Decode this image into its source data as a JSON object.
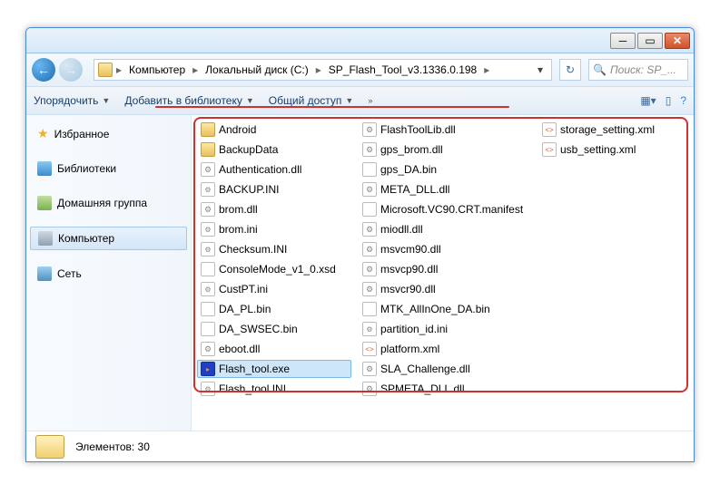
{
  "breadcrumb": {
    "seg1": "Компьютер",
    "seg2": "Локальный диск (C:)",
    "seg3": "SP_Flash_Tool_v3.1336.0.198"
  },
  "search": {
    "placeholder": "Поиск: SP_..."
  },
  "toolbar": {
    "organize": "Упорядочить",
    "addlib": "Добавить в библиотеку",
    "share": "Общий доступ"
  },
  "sidebar": {
    "fav": "Избранное",
    "lib": "Библиотеки",
    "home": "Домашняя группа",
    "comp": "Компьютер",
    "net": "Сеть"
  },
  "files": {
    "col1": [
      {
        "icon": "folder",
        "name": "Android"
      },
      {
        "icon": "folder",
        "name": "BackupData"
      },
      {
        "icon": "dll",
        "name": "Authentication.dll"
      },
      {
        "icon": "iniic",
        "name": "BACKUP.INI"
      },
      {
        "icon": "dll",
        "name": "brom.dll"
      },
      {
        "icon": "iniic",
        "name": "brom.ini"
      },
      {
        "icon": "iniic",
        "name": "Checksum.INI"
      },
      {
        "icon": "xsdic",
        "name": "ConsoleMode_v1_0.xsd"
      },
      {
        "icon": "iniic",
        "name": "CustPT.ini"
      },
      {
        "icon": "binic",
        "name": "DA_PL.bin"
      },
      {
        "icon": "binic",
        "name": "DA_SWSEC.bin"
      },
      {
        "icon": "dll",
        "name": "eboot.dll"
      },
      {
        "icon": "exeic",
        "name": "Flash_tool.exe",
        "sel": true
      },
      {
        "icon": "iniic",
        "name": "Flash_tool.INI"
      }
    ],
    "col2": [
      {
        "icon": "dll",
        "name": "FlashToolLib.dll"
      },
      {
        "icon": "dll",
        "name": "gps_brom.dll"
      },
      {
        "icon": "binic",
        "name": "gps_DA.bin"
      },
      {
        "icon": "dll",
        "name": "META_DLL.dll"
      },
      {
        "icon": "manic",
        "name": "Microsoft.VC90.CRT.manifest"
      },
      {
        "icon": "dll",
        "name": "miodll.dll"
      },
      {
        "icon": "dll",
        "name": "msvcm90.dll"
      },
      {
        "icon": "dll",
        "name": "msvcp90.dll"
      },
      {
        "icon": "dll",
        "name": "msvcr90.dll"
      },
      {
        "icon": "binic",
        "name": "MTK_AllInOne_DA.bin"
      },
      {
        "icon": "iniic",
        "name": "partition_id.ini"
      },
      {
        "icon": "xmlic",
        "name": "platform.xml"
      },
      {
        "icon": "dll",
        "name": "SLA_Challenge.dll"
      },
      {
        "icon": "dll",
        "name": "SPMETA_DLL.dll"
      }
    ],
    "col3": [
      {
        "icon": "xmlic",
        "name": "storage_setting.xml"
      },
      {
        "icon": "xmlic",
        "name": "usb_setting.xml"
      }
    ]
  },
  "status": {
    "count": "Элементов: 30"
  }
}
